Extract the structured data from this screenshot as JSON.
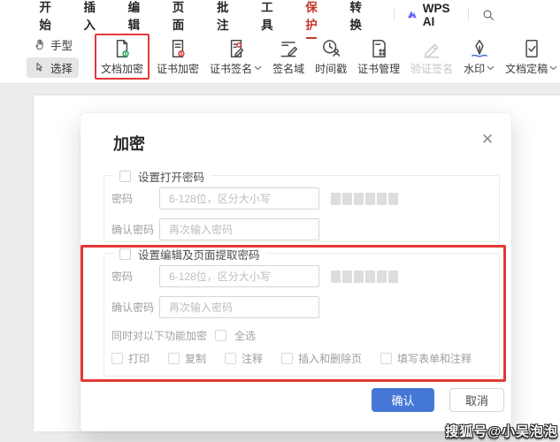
{
  "menu": {
    "tabs": [
      {
        "label": "开始",
        "active": false
      },
      {
        "label": "插入",
        "active": false
      },
      {
        "label": "编辑",
        "active": false
      },
      {
        "label": "页面",
        "active": false
      },
      {
        "label": "批注",
        "active": false
      },
      {
        "label": "工具",
        "active": false
      },
      {
        "label": "保护",
        "active": true
      },
      {
        "label": "转换",
        "active": false
      }
    ],
    "wps_ai_label": "WPS AI"
  },
  "toolbar": {
    "mode_tools": [
      {
        "label": "手型",
        "icon": "hand-icon",
        "selected": false
      },
      {
        "label": "选择",
        "icon": "cursor-icon",
        "selected": true
      }
    ],
    "tools": [
      {
        "label": "文档加密",
        "icon": "doc-lock-icon",
        "highlighted": true,
        "dropdown": false,
        "disabled": false
      },
      {
        "label": "证书加密",
        "icon": "cert-lock-icon",
        "highlighted": false,
        "dropdown": false,
        "disabled": false
      },
      {
        "label": "证书签名",
        "icon": "cert-sign-icon",
        "highlighted": false,
        "dropdown": true,
        "disabled": false
      },
      {
        "label": "签名域",
        "icon": "sign-field-icon",
        "highlighted": false,
        "dropdown": false,
        "disabled": false
      },
      {
        "label": "时间戳",
        "icon": "timestamp-icon",
        "highlighted": false,
        "dropdown": false,
        "disabled": false
      },
      {
        "label": "证书管理",
        "icon": "cert-manage-icon",
        "highlighted": false,
        "dropdown": false,
        "disabled": false
      },
      {
        "label": "验证签名",
        "icon": "verify-sign-icon",
        "highlighted": false,
        "dropdown": false,
        "disabled": true
      },
      {
        "label": "水印",
        "icon": "watermark-icon",
        "highlighted": false,
        "dropdown": true,
        "disabled": false
      },
      {
        "label": "文档定稿",
        "icon": "doc-final-icon",
        "highlighted": false,
        "dropdown": true,
        "disabled": false
      }
    ]
  },
  "dialog": {
    "title": "加密",
    "close_glyph": "✕",
    "open_section": {
      "checkbox_label": "设置打开密码",
      "password_label": "密码",
      "password_placeholder": "6-128位，区分大小写",
      "confirm_label": "确认密码",
      "confirm_placeholder": "再次输入密码",
      "strength_segments": 6
    },
    "edit_section": {
      "checkbox_label": "设置编辑及页面提取密码",
      "password_label": "密码",
      "password_placeholder": "6-128位，区分大小写",
      "confirm_label": "确认密码",
      "confirm_placeholder": "再次输入密码",
      "strength_segments": 6,
      "functions_label": "同时对以下功能加密",
      "select_all_label": "全选",
      "function_options": [
        {
          "label": "打印"
        },
        {
          "label": "复制"
        },
        {
          "label": "注释"
        },
        {
          "label": "插入和删除页"
        },
        {
          "label": "填写表单和注释"
        }
      ]
    },
    "confirm_label": "确认",
    "cancel_label": "取消"
  },
  "watermark": "搜狐号@小吴泡泡",
  "colors": {
    "annotation_red": "#e23936",
    "active_tab_red": "#c4382e",
    "primary_blue": "#4577d6",
    "lock_green": "#27a65a",
    "lock_red": "#d0393b"
  }
}
